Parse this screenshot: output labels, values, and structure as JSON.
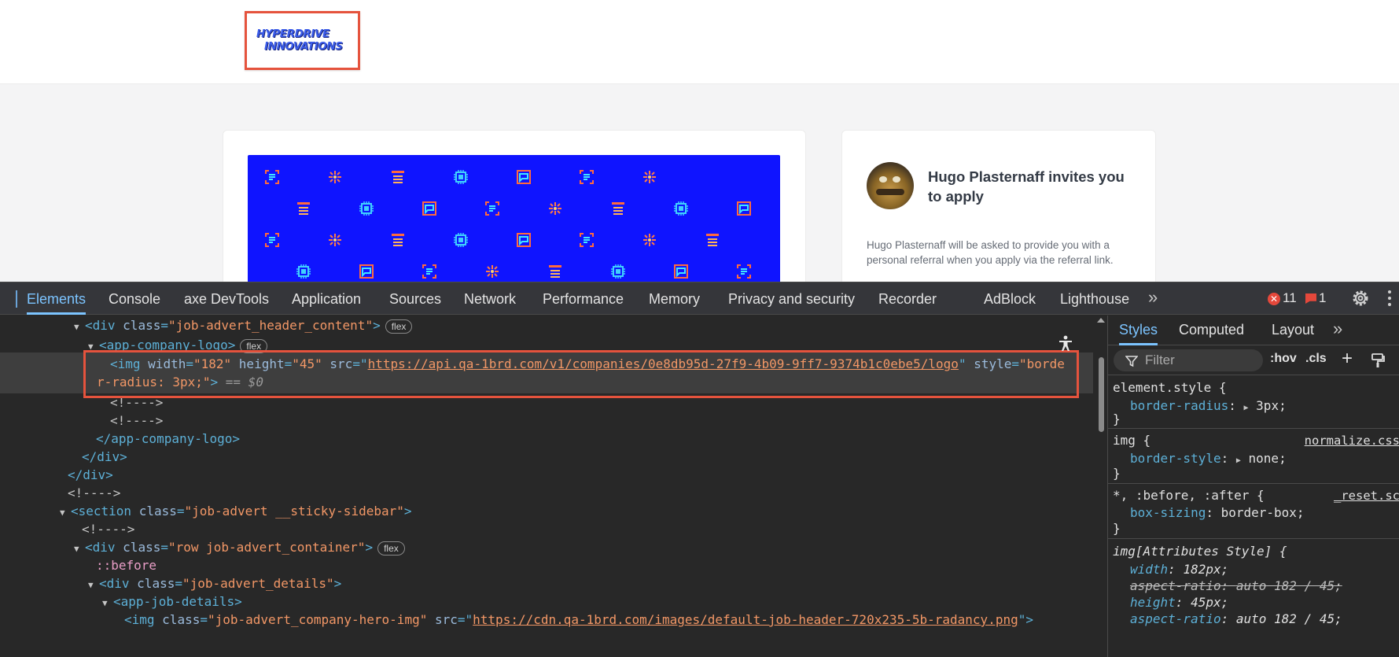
{
  "page": {
    "logo_line1": "HYPERDRIVE",
    "logo_line2": "INNOVATIONS",
    "invite_title": "Hugo Plasternaff invites you to apply",
    "invite_body": "Hugo Plasternaff will be asked to provide you with a personal referral when you apply via the referral link."
  },
  "devtools": {
    "tabs": [
      "Elements",
      "Console",
      "axe DevTools",
      "Application",
      "Sources",
      "Network",
      "Performance",
      "Memory",
      "Privacy and security",
      "Recorder",
      "AdBlock",
      "Lighthouse"
    ],
    "error_count": "11",
    "warning_count": "1",
    "tree": {
      "r1_tag_open": "<div",
      "r1_attr": "class",
      "r1_val": "\"job-advert_header_content\"",
      "r1_close": ">",
      "r1_pill": "flex",
      "r2_tag": "<app-company-logo>",
      "r2_pill": "flex",
      "r3_a": "<img",
      "r3_w_attr": "width",
      "r3_w_val": "\"182\"",
      "r3_h_attr": "height",
      "r3_h_val": "\"45\"",
      "r3_src_attr": "src",
      "r3_src_val": "https://api.qa-1brd.com/v1/companies/0e8db95d-27f9-4b09-9ff7-9374b1c0ebe5/logo",
      "r3_style_attr": "style",
      "r3_style_val": "\"borde",
      "r4_style_val": "r-radius: 3px;\"",
      "r4_close": ">",
      "r4_eq": "== $0",
      "r5": "<!---->",
      "r6": "<!---->",
      "r7": "</app-company-logo>",
      "r8": "</div>",
      "r9": "</div>",
      "r10": "<!---->",
      "r11_tag": "<section",
      "r11_attr": "class",
      "r11_val": "\"job-advert __sticky-sidebar\"",
      "r12": "<!---->",
      "r13_tag": "<div",
      "r13_attr": "class",
      "r13_val": "\"row job-advert_container\"",
      "r13_pill": "flex",
      "r14": "::before",
      "r15_tag": "<div",
      "r15_attr": "class",
      "r15_val": "\"job-advert_details\"",
      "r16": "<app-job-details>",
      "r17_tag": "<img",
      "r17_attr": "class",
      "r17_val": "\"job-advert_company-hero-img\"",
      "r17_src_attr": "src",
      "r17_src_val": "https://cdn.qa-1brd.com/images/default-job-header-720x235-5b-radancy.png"
    },
    "styles_tabs": [
      "Styles",
      "Computed",
      "Layout"
    ],
    "filter_placeholder": "Filter",
    "hov": ":hov",
    "cls": ".cls",
    "rules": {
      "r1_sel": "element.style {",
      "r1_p": "border-radius",
      "r1_v": "3px;",
      "r2_sel": "img {",
      "r2_src": "normalize.css",
      "r2_p": "border-style",
      "r2_v": "none;",
      "r3_sel": "*, :before, :after {",
      "r3_src": "_reset.sc",
      "r3_p": "box-sizing",
      "r3_v": "border-box;",
      "r4_sel": "img[Attributes Style] {",
      "r4_p1": "width",
      "r4_v1": "182px;",
      "r4_p2": "aspect-ratio",
      "r4_v2": "auto 182 / 45;",
      "r4_p3": "height",
      "r4_v3": "45px;",
      "r4_p4": "aspect-ratio",
      "r4_v4": "auto 182 / 45;",
      "close": "}"
    }
  },
  "colors": {
    "highlight_border": "#e5533d",
    "hero_blue": "#0f14ff",
    "devtools_accent": "#7cc4ff"
  }
}
